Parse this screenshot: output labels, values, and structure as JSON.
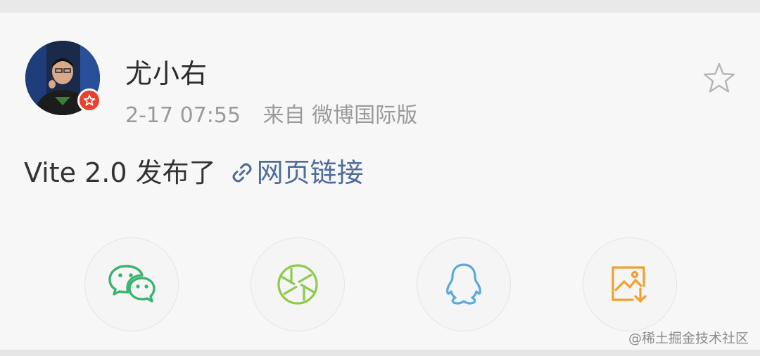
{
  "post": {
    "author": "尤小右",
    "time": "2-17 07:55",
    "source": "来自 微博国际版",
    "text": "Vite 2.0 发布了",
    "link_label": "网页链接"
  },
  "share_targets": [
    {
      "name": "WeChat",
      "icon": "wechat-icon",
      "color": "#3cb371"
    },
    {
      "name": "Moments",
      "icon": "moments-icon",
      "color": "#8fc94e"
    },
    {
      "name": "QQ",
      "icon": "qq-icon",
      "color": "#5aa9de"
    },
    {
      "name": "Save image",
      "icon": "save-image-icon",
      "color": "#f0a030"
    }
  ],
  "watermark": "@稀土掘金技术社区",
  "colors": {
    "link": "#4f6c9a",
    "badge": "#e9412f",
    "meta": "#9a9a9a"
  }
}
